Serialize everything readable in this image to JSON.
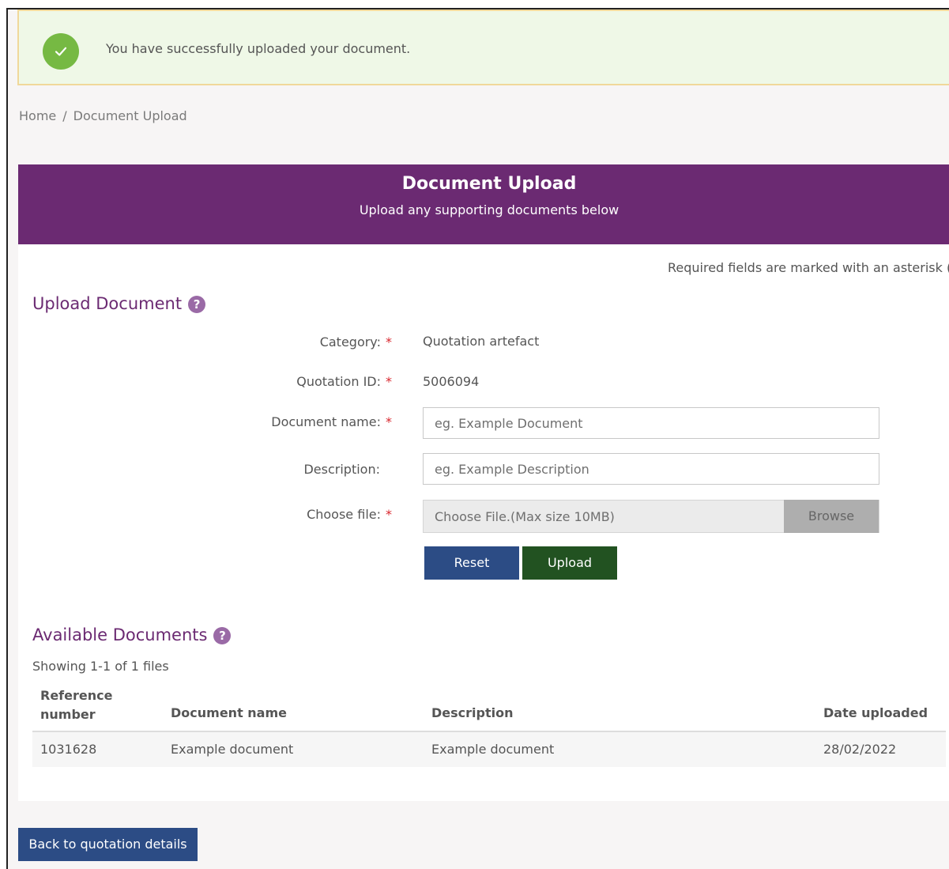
{
  "alert": {
    "message": "You have successfully uploaded your document.",
    "icon": "check-icon",
    "color": "#76b943"
  },
  "breadcrumb": {
    "home": "Home",
    "separator": "/",
    "current": "Document Upload"
  },
  "banner": {
    "title": "Document Upload",
    "subtitle": "Upload any supporting documents below",
    "color": "#6b2a72"
  },
  "required_note": {
    "text": "Required fields are marked with an asterisk (",
    "asterisk": "*"
  },
  "upload_section": {
    "heading": "Upload Document",
    "help": "?"
  },
  "form": {
    "required_marker": "*",
    "category": {
      "label": "Category:",
      "value": "Quotation artefact"
    },
    "quotation_id": {
      "label": "Quotation ID:",
      "value": "5006094"
    },
    "document_name": {
      "label": "Document name:",
      "value": "",
      "placeholder": "eg. Example Document"
    },
    "description": {
      "label": "Description:",
      "value": "",
      "placeholder": "eg. Example Description"
    },
    "choose_file": {
      "label": "Choose file:",
      "placeholder": "Choose File.(Max size 10MB)",
      "browse_label": "Browse"
    },
    "reset_label": "Reset",
    "upload_label": "Upload"
  },
  "documents_section": {
    "heading": "Available Documents",
    "help": "?",
    "showing": "Showing 1-1 of 1 files",
    "columns": {
      "reference_line1": "Reference",
      "reference_line2": "number",
      "document_name": "Document name",
      "description": "Description",
      "date_uploaded": "Date uploaded"
    },
    "rows": [
      {
        "reference": "1031628",
        "document_name": "Example document",
        "description": "Example document",
        "date_uploaded": "28/02/2022"
      }
    ]
  },
  "back_button": {
    "label": "Back to quotation details"
  },
  "colors": {
    "primary_blue": "#2c4c85",
    "upload_green": "#225221",
    "required_red": "#d9262e"
  }
}
